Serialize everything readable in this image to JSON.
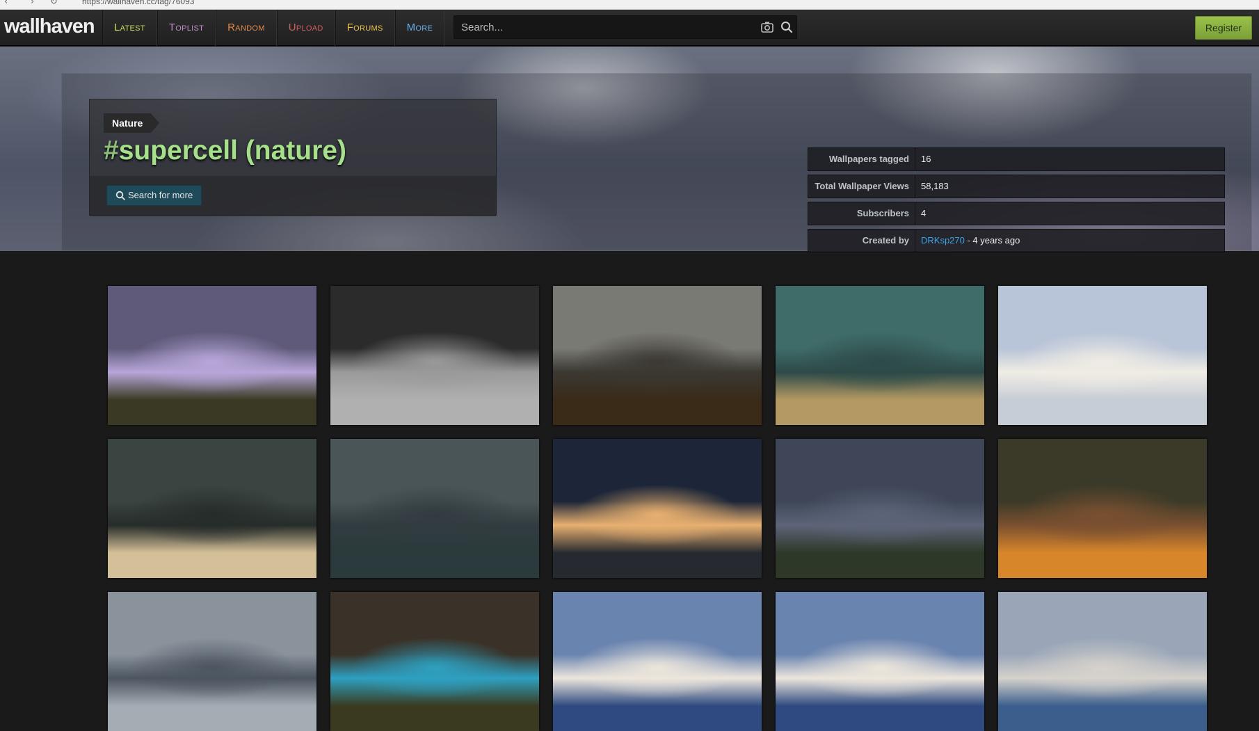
{
  "browser": {
    "back_glyph": "‹",
    "forward_glyph": "›",
    "reload_glyph": "↻",
    "url_text": "https://wallhaven.cc/tag/76093"
  },
  "header": {
    "logo": "wallhaven",
    "nav": [
      {
        "label": "Latest",
        "color": "#c5dd5c"
      },
      {
        "label": "Toplist",
        "color": "#c18ec9"
      },
      {
        "label": "Random",
        "color": "#e08b4d"
      },
      {
        "label": "Upload",
        "color": "#d1605d"
      },
      {
        "label": "Forums",
        "color": "#e8c24c"
      },
      {
        "label": "More",
        "color": "#6aaee6"
      }
    ],
    "search_placeholder": "Search...",
    "camera_icon": "camera-icon",
    "search_icon": "search-icon",
    "register_label": "Register"
  },
  "tag": {
    "category": "Nature",
    "hash": "#",
    "name": "supercell (nature)",
    "search_more_label": "Search for more"
  },
  "stats": [
    {
      "label": "Wallpapers tagged",
      "value": "16"
    },
    {
      "label": "Total Wallpaper Views",
      "value": "58,183"
    },
    {
      "label": "Subscribers",
      "value": "4"
    },
    {
      "label": "Created by",
      "user": "DRKsp270",
      "suffix": " - 4 years ago"
    }
  ],
  "thumbnails": [
    {
      "desc": "supercell-thumb-1",
      "sky": "#5f5a7a",
      "mid": "#b7a6d9",
      "ground": "#3a3a24"
    },
    {
      "desc": "supercell-thumb-2",
      "sky": "#2b2b2b",
      "mid": "#9a9a9a",
      "ground": "#b0b0b0"
    },
    {
      "desc": "supercell-thumb-3",
      "sky": "#7a7a74",
      "mid": "#3b3832",
      "ground": "#3a2b18"
    },
    {
      "desc": "supercell-thumb-4",
      "sky": "#3f6b68",
      "mid": "#2d4a48",
      "ground": "#b49a62"
    },
    {
      "desc": "supercell-thumb-5",
      "sky": "#b8c4d8",
      "mid": "#f0ece4",
      "ground": "#c7cdd6"
    },
    {
      "desc": "supercell-thumb-6",
      "sky": "#3a4440",
      "mid": "#262c2a",
      "ground": "#d4c098"
    },
    {
      "desc": "supercell-thumb-7",
      "sky": "#4a5558",
      "mid": "#323c40",
      "ground": "#2b3a3c"
    },
    {
      "desc": "supercell-thumb-8",
      "sky": "#1c2638",
      "mid": "#e8b070",
      "ground": "#262a30"
    },
    {
      "desc": "supercell-thumb-9",
      "sky": "#3e4658",
      "mid": "#5d6478",
      "ground": "#2e3828"
    },
    {
      "desc": "supercell-thumb-10",
      "sky": "#3b3a28",
      "mid": "#7a5030",
      "ground": "#d8862a"
    },
    {
      "desc": "supercell-thumb-11",
      "sky": "#8a939c",
      "mid": "#4c5560",
      "ground": "#a4acb4"
    },
    {
      "desc": "supercell-thumb-12",
      "sky": "#3a3228",
      "mid": "#2ea0c0",
      "ground": "#3a3a20"
    },
    {
      "desc": "supercell-thumb-13",
      "sky": "#6a84b0",
      "mid": "#ece6dc",
      "ground": "#2e4a80"
    },
    {
      "desc": "supercell-thumb-14",
      "sky": "#6a84b0",
      "mid": "#ece6dc",
      "ground": "#2e4a80"
    },
    {
      "desc": "supercell-thumb-15",
      "sky": "#9aa6b8",
      "mid": "#d6d2cc",
      "ground": "#3c5e8c"
    }
  ]
}
